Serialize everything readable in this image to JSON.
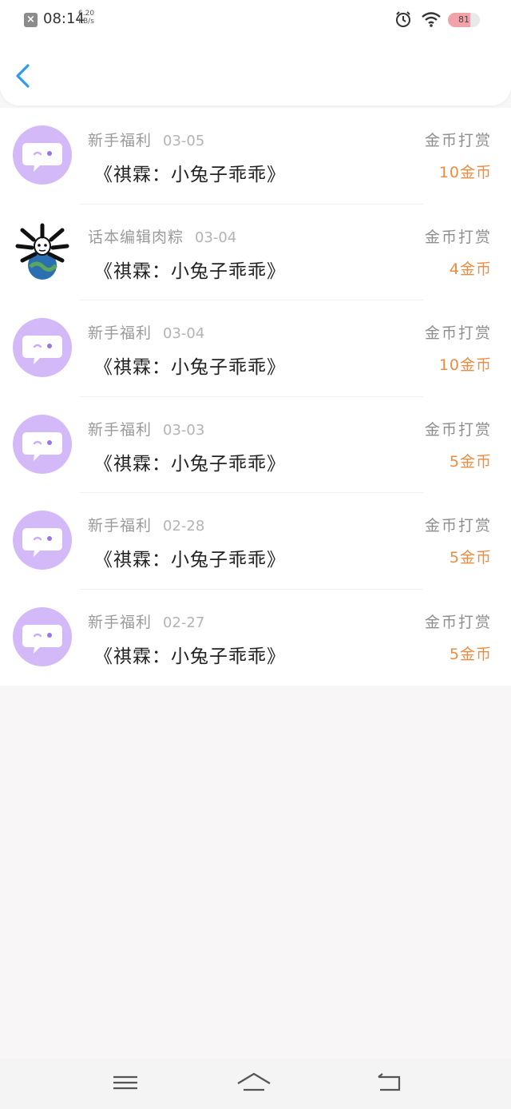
{
  "status_bar": {
    "time": "08:14",
    "speed_value": "6.20",
    "speed_unit": "KB/s",
    "battery_level": "81"
  },
  "colors": {
    "accent_blue": "#2d9bf0",
    "avatar_purple": "#d3b9f7",
    "amount_orange": "#f08b3d"
  },
  "records": [
    {
      "avatar": "chat-bubble-icon",
      "sender": "新手福利",
      "date": "03-05",
      "book": "《祺霖：小兔子乖乖》",
      "type": "金币打赏",
      "amount": "10金币"
    },
    {
      "avatar": "user-photo",
      "sender": "话本编辑肉粽",
      "date": "03-04",
      "book": "《祺霖：小兔子乖乖》",
      "type": "金币打赏",
      "amount": "4金币"
    },
    {
      "avatar": "chat-bubble-icon",
      "sender": "新手福利",
      "date": "03-04",
      "book": "《祺霖：小兔子乖乖》",
      "type": "金币打赏",
      "amount": "10金币"
    },
    {
      "avatar": "chat-bubble-icon",
      "sender": "新手福利",
      "date": "03-03",
      "book": "《祺霖：小兔子乖乖》",
      "type": "金币打赏",
      "amount": "5金币"
    },
    {
      "avatar": "chat-bubble-icon",
      "sender": "新手福利",
      "date": "02-28",
      "book": "《祺霖：小兔子乖乖》",
      "type": "金币打赏",
      "amount": "5金币"
    },
    {
      "avatar": "chat-bubble-icon",
      "sender": "新手福利",
      "date": "02-27",
      "book": "《祺霖：小兔子乖乖》",
      "type": "金币打赏",
      "amount": "5金币"
    }
  ],
  "nav_bar": {
    "menu_icon": "menu-icon",
    "home_icon": "home-icon",
    "back_icon": "return-icon"
  }
}
